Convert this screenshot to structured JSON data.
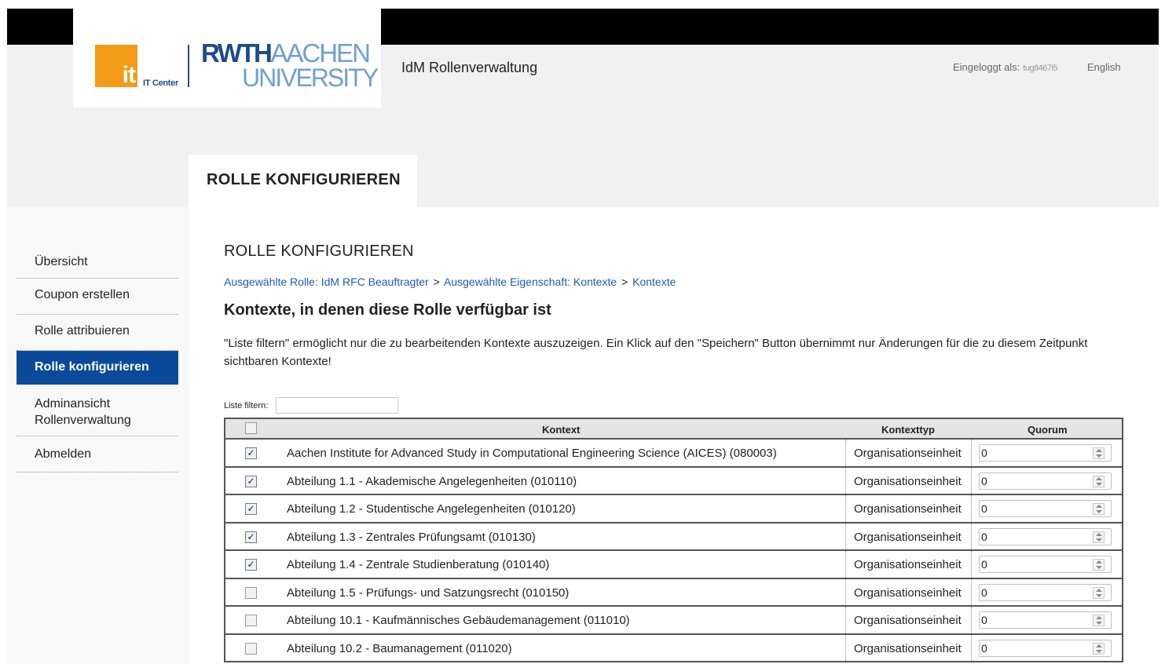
{
  "header": {
    "logo": {
      "it_mark": "it",
      "it_center": "IT Center",
      "rwth": "RWTH",
      "aachen": "AACHEN",
      "university": "UNIVERSITY"
    },
    "app_title": "IdM Rollenverwaltung",
    "login_label": "Eingeloggt als:",
    "login_user": "tug8467i5",
    "language_link": "English"
  },
  "page_tab": "ROLLE KONFIGURIEREN",
  "sidebar": {
    "items": [
      {
        "label": "Übersicht",
        "active": false
      },
      {
        "label": "Coupon erstellen",
        "active": false
      },
      {
        "label": "Rolle attribuieren",
        "active": false
      },
      {
        "label": "Rolle konfigurieren",
        "active": true
      },
      {
        "label": "Adminansicht Rollenverwaltung",
        "active": false
      },
      {
        "label": "Abmelden",
        "active": false
      }
    ]
  },
  "content": {
    "title": "ROLLE KONFIGURIEREN",
    "breadcrumb": [
      "Ausgewählte Rolle: IdM RFC Beauftragter",
      "Ausgewählte Eigenschaft: Kontexte",
      "Kontexte"
    ],
    "breadcrumb_separator": ">",
    "heading": "Kontexte, in denen diese Rolle verfügbar ist",
    "description": "\"Liste filtern\" ermöglicht nur die zu bearbeitenden Kontexte auszuzeigen. Ein Klick auf den \"Speichern\" Button übernimmt nur Änderungen für die zu diesem Zeitpunkt sichtbaren Kontexte!",
    "filter_label": "Liste filtern:",
    "filter_value": ""
  },
  "table": {
    "headers": {
      "kontext": "Kontext",
      "kontexttyp": "Kontexttyp",
      "quorum": "Quorum"
    },
    "rows": [
      {
        "checked": true,
        "kontext": "Aachen Institute for Advanced Study in Computational Engineering Science (AICES) (080003)",
        "kontexttyp": "Organisationseinheit",
        "quorum": "0"
      },
      {
        "checked": true,
        "kontext": "Abteilung 1.1 - Akademische Angelegenheiten (010110)",
        "kontexttyp": "Organisationseinheit",
        "quorum": "0"
      },
      {
        "checked": true,
        "kontext": "Abteilung 1.2 - Studentische Angelegenheiten (010120)",
        "kontexttyp": "Organisationseinheit",
        "quorum": "0"
      },
      {
        "checked": true,
        "kontext": "Abteilung 1.3 - Zentrales Prüfungsamt (010130)",
        "kontexttyp": "Organisationseinheit",
        "quorum": "0"
      },
      {
        "checked": true,
        "kontext": "Abteilung 1.4 - Zentrale Studienberatung (010140)",
        "kontexttyp": "Organisationseinheit",
        "quorum": "0"
      },
      {
        "checked": false,
        "kontext": "Abteilung 1.5 - Prüfungs- und Satzungsrecht (010150)",
        "kontexttyp": "Organisationseinheit",
        "quorum": "0"
      },
      {
        "checked": false,
        "kontext": "Abteilung 10.1 - Kaufmännisches Gebäudemanagement (011010)",
        "kontexttyp": "Organisationseinheit",
        "quorum": "0"
      },
      {
        "checked": false,
        "kontext": "Abteilung 10.2 - Baumanagement (011020)",
        "kontexttyp": "Organisationseinheit",
        "quorum": "0"
      }
    ]
  },
  "colors": {
    "accent": "#0b4a9a",
    "link": "#1e5cb3",
    "logo_orange": "#f39b17",
    "logo_blue": "#1e4a8c",
    "logo_lightblue": "#6f9ed8"
  }
}
